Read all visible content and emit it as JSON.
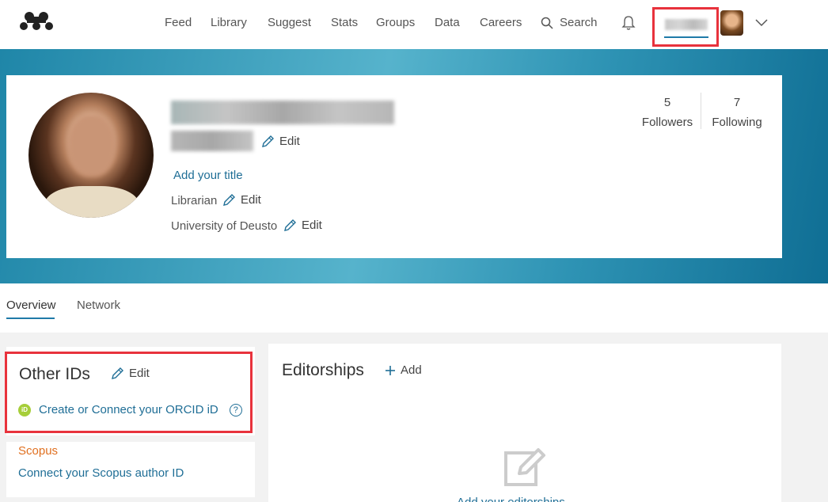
{
  "nav": {
    "items": [
      "Feed",
      "Library",
      "Suggest",
      "Stats",
      "Groups",
      "Data",
      "Careers"
    ],
    "search_label": "Search"
  },
  "profile": {
    "edit_label": "Edit",
    "add_title_label": "Add your title",
    "role": "Librarian",
    "institution": "University of Deusto",
    "followers_count": "5",
    "followers_label": "Followers",
    "following_count": "7",
    "following_label": "Following"
  },
  "tabs": [
    "Overview",
    "Network"
  ],
  "other_ids": {
    "title": "Other IDs",
    "edit_label": "Edit",
    "orcid_badge": "iD",
    "orcid_link": "Create or Connect your ORCID iD",
    "help": "?",
    "scopus_label": "Scopus",
    "scopus_link": "Connect your Scopus author ID"
  },
  "editorships": {
    "title": "Editorships",
    "add_label": "Add",
    "hint": "Add your editorships"
  },
  "colors": {
    "accent": "#1f7aa8",
    "highlight": "#e8323c",
    "scopus": "#e07020",
    "orcid": "#a6ce39"
  }
}
